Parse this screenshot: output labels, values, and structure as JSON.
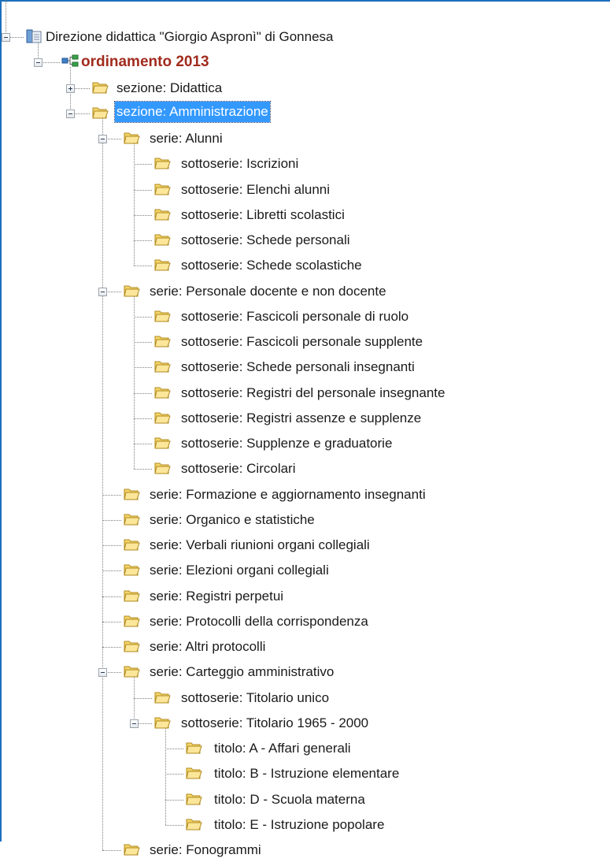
{
  "tree": {
    "rows": [
      {
        "label": "Direzione didattica \"Giorgio Aspronì\" di Gonnesa",
        "level": 0,
        "icon": "database-icon",
        "toggle": "minus",
        "style": "root"
      },
      {
        "label": "ordinamento 2013",
        "level": 1,
        "icon": "hierarchy-icon",
        "toggle": "minus",
        "style": "project"
      },
      {
        "label": "sezione: Didattica",
        "level": 2,
        "icon": "folder-icon",
        "toggle": "plus"
      },
      {
        "label": "sezione: Amministrazione",
        "level": 2,
        "icon": "folder-icon",
        "toggle": "minus",
        "selected": true
      },
      {
        "label": "serie: Alunni",
        "level": 3,
        "icon": "folder-icon",
        "toggle": "minus"
      },
      {
        "label": "sottoserie: Iscrizioni",
        "level": 4,
        "icon": "folder-icon"
      },
      {
        "label": "sottoserie: Elenchi alunni",
        "level": 4,
        "icon": "folder-icon"
      },
      {
        "label": "sottoserie: Libretti scolastici",
        "level": 4,
        "icon": "folder-icon"
      },
      {
        "label": "sottoserie: Schede personali",
        "level": 4,
        "icon": "folder-icon"
      },
      {
        "label": "sottoserie: Schede scolastiche",
        "level": 4,
        "icon": "folder-icon"
      },
      {
        "label": "serie: Personale docente e non docente",
        "level": 3,
        "icon": "folder-icon",
        "toggle": "minus"
      },
      {
        "label": "sottoserie: Fascicoli personale di ruolo",
        "level": 4,
        "icon": "folder-icon"
      },
      {
        "label": "sottoserie: Fascicoli personale supplente",
        "level": 4,
        "icon": "folder-icon"
      },
      {
        "label": "sottoserie: Schede personali insegnanti",
        "level": 4,
        "icon": "folder-icon"
      },
      {
        "label": "sottoserie: Registri del personale insegnante",
        "level": 4,
        "icon": "folder-icon"
      },
      {
        "label": "sottoserie: Registri assenze e supplenze",
        "level": 4,
        "icon": "folder-icon"
      },
      {
        "label": "sottoserie: Supplenze e graduatorie",
        "level": 4,
        "icon": "folder-icon"
      },
      {
        "label": "sottoserie: Circolari",
        "level": 4,
        "icon": "folder-icon"
      },
      {
        "label": "serie: Formazione e aggiornamento insegnanti",
        "level": 3,
        "icon": "folder-icon"
      },
      {
        "label": "serie: Organico e statistiche",
        "level": 3,
        "icon": "folder-icon"
      },
      {
        "label": "serie: Verbali riunioni organi collegiali",
        "level": 3,
        "icon": "folder-icon"
      },
      {
        "label": "serie: Elezioni organi collegiali",
        "level": 3,
        "icon": "folder-icon"
      },
      {
        "label": "serie: Registri perpetui",
        "level": 3,
        "icon": "folder-icon"
      },
      {
        "label": "serie: Protocolli della corrispondenza",
        "level": 3,
        "icon": "folder-icon"
      },
      {
        "label": "serie: Altri protocolli",
        "level": 3,
        "icon": "folder-icon"
      },
      {
        "label": "serie: Carteggio amministrativo",
        "level": 3,
        "icon": "folder-icon",
        "toggle": "minus"
      },
      {
        "label": "sottoserie: Titolario unico",
        "level": 4,
        "icon": "folder-icon"
      },
      {
        "label": "sottoserie: Titolario 1965 - 2000",
        "level": 4,
        "icon": "folder-icon",
        "toggle": "minus"
      },
      {
        "label": "titolo: A - Affari generali",
        "level": 5,
        "icon": "folder-icon"
      },
      {
        "label": "titolo: B - Istruzione elementare",
        "level": 5,
        "icon": "folder-icon"
      },
      {
        "label": "titolo: D - Scuola materna",
        "level": 5,
        "icon": "folder-icon"
      },
      {
        "label": "titolo: E - Istruzione popolare",
        "level": 5,
        "icon": "folder-icon"
      },
      {
        "label": "serie: Fonogrammi",
        "level": 3,
        "icon": "folder-icon"
      }
    ]
  },
  "colors": {
    "frame_border": "#1c6fbd",
    "selection_bg": "#3399ff",
    "project_text": "#a12b1e",
    "folder_fill": "#f5d56a",
    "folder_stroke": "#b08a1e"
  }
}
